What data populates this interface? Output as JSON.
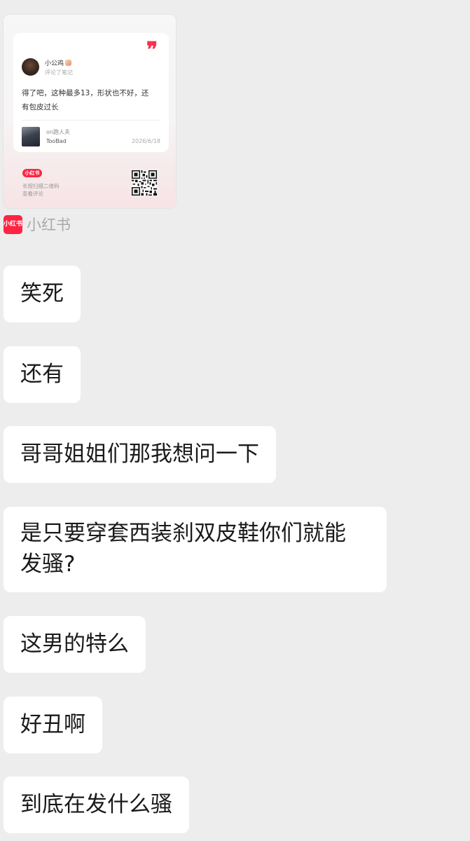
{
  "share_card": {
    "quote_mark": "❞",
    "username": "小公鸡",
    "subtext": "评论了笔记",
    "comment_line1": "得了吧，这种最多13，形状也不好，还",
    "comment_line2": "有包皮过长",
    "note_title": "on跑人夫",
    "note_author": "TooBad",
    "note_date": "2026/6/18",
    "brand_badge": "小红书",
    "scan_hint_line1": "长按扫描二维码",
    "scan_hint_line2": "查看评论"
  },
  "source": {
    "logo_text": "小红书",
    "name": "小红书"
  },
  "messages": [
    {
      "text": "笑死"
    },
    {
      "text": "还有"
    },
    {
      "text": "哥哥姐姐们那我想问一下"
    },
    {
      "text_line1": "是只要穿套西装刹双皮鞋你们就能",
      "text_line2": "发骚?"
    },
    {
      "text": "这男的特么"
    },
    {
      "text": "好丑啊"
    },
    {
      "text": "到底在发什么骚"
    }
  ],
  "colors": {
    "background": "#ededed",
    "bubble": "#ffffff",
    "brand_red": "#ff2442"
  }
}
